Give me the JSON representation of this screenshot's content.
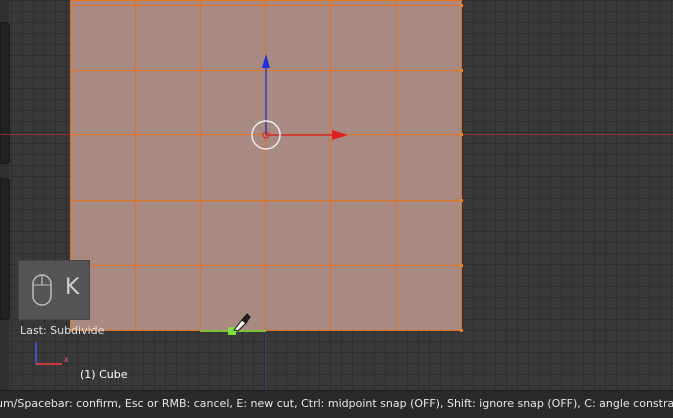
{
  "viewport": {
    "last_operator": "Last: Subdivide",
    "object_name": "(1) Cube",
    "key_overlay": {
      "key": "K",
      "icon": "mouse-icon"
    },
    "mini_axes": {
      "x_label": "x"
    },
    "colors": {
      "mesh_face": "#a88a82",
      "mesh_edges": "#e8701a",
      "x_axis": "#cc2a2a",
      "z_axis": "#2a3acc",
      "knife_cut": "#7fdf3f",
      "background": "#393939"
    }
  },
  "status_bar": {
    "text": "um/Spacebar: confirm, Esc or RMB: cancel, E: new cut, Ctrl: midpoint snap (OFF), Shift: ignore snap (OFF), C: angle constrain (OFF), Z: cut"
  }
}
